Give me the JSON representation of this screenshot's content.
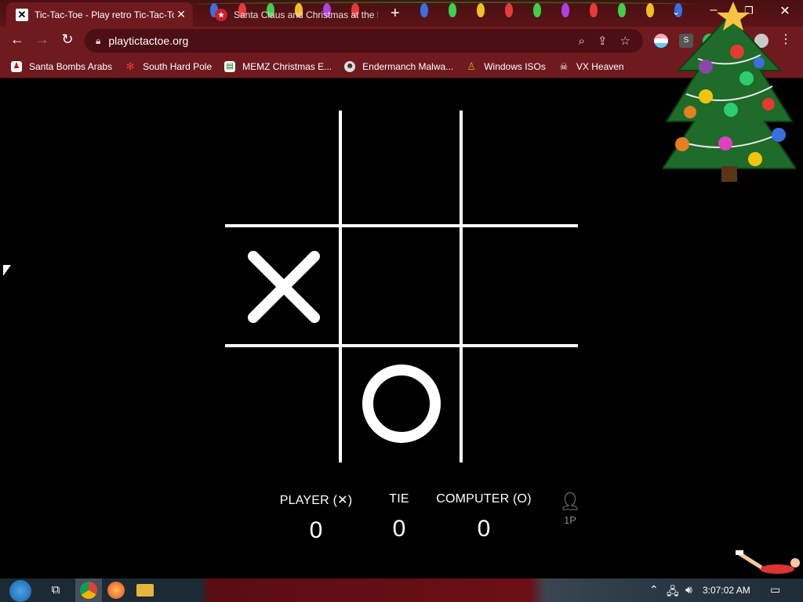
{
  "browser": {
    "tabs": [
      {
        "title": "Tic-Tac-Toe - Play retro Tic-Tac-Toe",
        "active": true
      },
      {
        "title": "Santa Claus and Christmas at the North Pole",
        "active": false
      }
    ],
    "url": "playtictactoe.org",
    "bookmarks": [
      {
        "label": "Santa Bombs Arabs"
      },
      {
        "label": "South Hard Pole"
      },
      {
        "label": "MEMZ Christmas E..."
      },
      {
        "label": "Endermanch Malwa..."
      },
      {
        "label": "Windows ISOs"
      },
      {
        "label": "VX Heaven"
      }
    ]
  },
  "game": {
    "board": [
      "",
      "",
      "",
      "X",
      "",
      "",
      "",
      "O",
      ""
    ],
    "scores": {
      "player_label": "PLAYER (✕)",
      "player_score": "0",
      "tie_label": "TIE",
      "tie_score": "0",
      "computer_label": "COMPUTER (O)",
      "computer_score": "0"
    },
    "mode_label": "1P"
  },
  "taskbar": {
    "time": "3:07:02 AM"
  },
  "colors": {
    "chrome": "#6e1a1f",
    "tabstrip": "#4a0f12",
    "page_bg": "#000000",
    "lines": "#ffffff"
  }
}
